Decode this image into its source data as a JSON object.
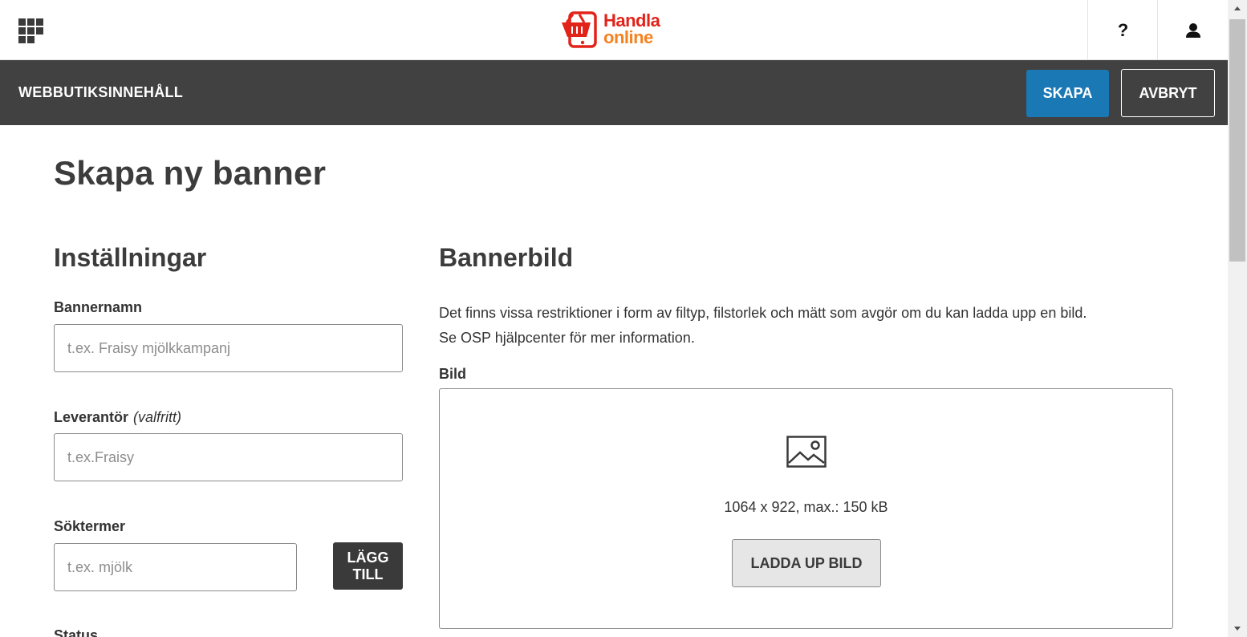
{
  "header": {
    "apps_icon": "grid-icon",
    "logo": {
      "line1": "Handla",
      "line2": "online",
      "color1": "#e2231a",
      "color2": "#f58220"
    },
    "help_label": "?",
    "user_icon": "user-icon"
  },
  "actionbar": {
    "section_title": "WEBBUTIKSINNEHÅLL",
    "create_label": "SKAPA",
    "cancel_label": "AVBRYT",
    "create_color": "#1a78b4",
    "bar_color": "#414141"
  },
  "page": {
    "title": "Skapa ny banner"
  },
  "settings": {
    "heading": "Inställningar",
    "banner_name": {
      "label": "Bannernamn",
      "placeholder": "t.ex. Fraisy mjölkkampanj",
      "value": ""
    },
    "supplier": {
      "label": "Leverantör",
      "optional": "(valfritt)",
      "placeholder": "t.ex.Fraisy",
      "value": ""
    },
    "search_terms": {
      "label": "Söktermer",
      "placeholder": "t.ex. mjölk",
      "value": "",
      "add_label_line1": "LÄGG",
      "add_label_line2": "TILL"
    },
    "status": {
      "label": "Status"
    }
  },
  "banner_image": {
    "heading": "Bannerbild",
    "description_line1": "Det finns vissa restriktioner i form av filtyp, filstorlek och mätt som avgör om du kan ladda upp en bild.",
    "description_line2": "Se OSP hjälpcenter för mer information.",
    "image_label": "Bild",
    "image_icon": "image-icon",
    "dimensions": "1064 x 922, max.: 150 kB",
    "upload_label": "LADDA UP BILD"
  }
}
